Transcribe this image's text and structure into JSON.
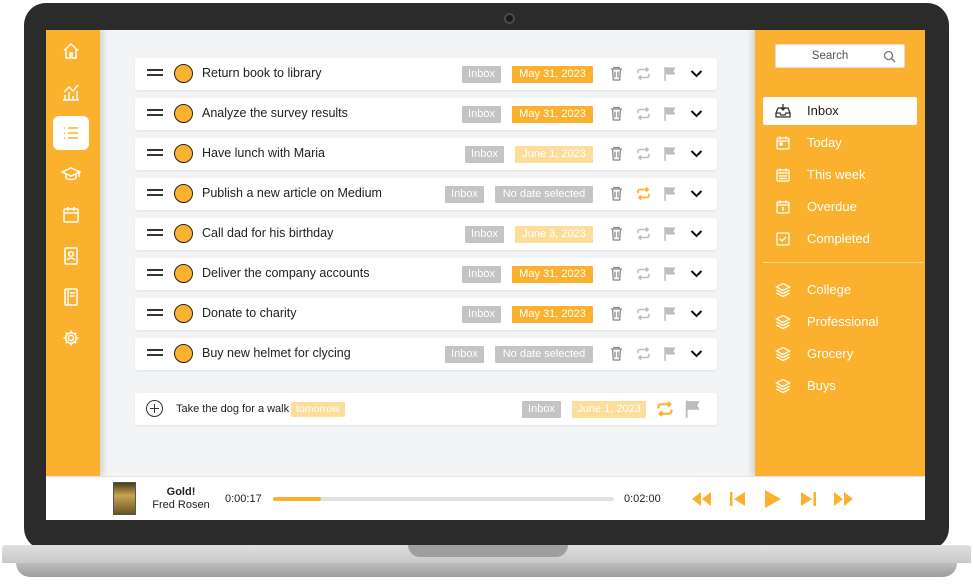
{
  "colors": {
    "accent": "#fbb12e",
    "accent_light": "#fddd9a",
    "gray_badge": "#c4c4c4"
  },
  "left_nav": [
    {
      "icon": "home-icon"
    },
    {
      "icon": "chart-icon"
    },
    {
      "icon": "list-icon",
      "active": true
    },
    {
      "icon": "graduation-cap-icon"
    },
    {
      "icon": "calendar-icon"
    },
    {
      "icon": "contacts-icon"
    },
    {
      "icon": "book-icon"
    },
    {
      "icon": "gear-icon"
    }
  ],
  "tasks": [
    {
      "title": "Return book to library",
      "list": "Inbox",
      "date": "May 31, 2023",
      "date_style": "strong",
      "repeat_active": false
    },
    {
      "title": "Analyze the survey results",
      "list": "Inbox",
      "date": "May 31, 2023",
      "date_style": "strong",
      "repeat_active": false
    },
    {
      "title": "Have lunch with Maria",
      "list": "Inbox",
      "date": "June 1, 2023",
      "date_style": "light",
      "repeat_active": false
    },
    {
      "title": "Publish a new article on Medium",
      "list": "Inbox",
      "date": "No date selected",
      "date_style": "none",
      "repeat_active": true
    },
    {
      "title": "Call dad for his birthday",
      "list": "Inbox",
      "date": "June 3, 2023",
      "date_style": "light",
      "repeat_active": false
    },
    {
      "title": "Deliver the company accounts",
      "list": "Inbox",
      "date": "May 31, 2023",
      "date_style": "strong",
      "repeat_active": false
    },
    {
      "title": "Donate to charity",
      "list": "Inbox",
      "date": "May 31, 2023",
      "date_style": "strong",
      "repeat_active": false
    },
    {
      "title": "Buy new helmet for clycing",
      "list": "Inbox",
      "date": "No date selected",
      "date_style": "none",
      "repeat_active": false
    }
  ],
  "new_task": {
    "text": "Take the dog for a walk",
    "keyword": "tomorrow",
    "list": "Inbox",
    "date": "June 1, 2023"
  },
  "search": {
    "placeholder": "Search"
  },
  "filters": [
    {
      "label": "Inbox",
      "icon": "inbox-icon",
      "active": true
    },
    {
      "label": "Today",
      "icon": "calendar-today-icon"
    },
    {
      "label": "This week",
      "icon": "calendar-week-icon"
    },
    {
      "label": "Overdue",
      "icon": "calendar-overdue-icon"
    },
    {
      "label": "Completed",
      "icon": "check-square-icon"
    }
  ],
  "projects": [
    {
      "label": "College",
      "icon": "layers-icon"
    },
    {
      "label": "Professional",
      "icon": "layers-icon"
    },
    {
      "label": "Grocery",
      "icon": "layers-icon"
    },
    {
      "label": "Buys",
      "icon": "layers-icon"
    }
  ],
  "player": {
    "title": "Gold!",
    "artist": "Fred Rosen",
    "elapsed": "0:00:17",
    "total": "0:02:00",
    "progress": 0.14
  }
}
